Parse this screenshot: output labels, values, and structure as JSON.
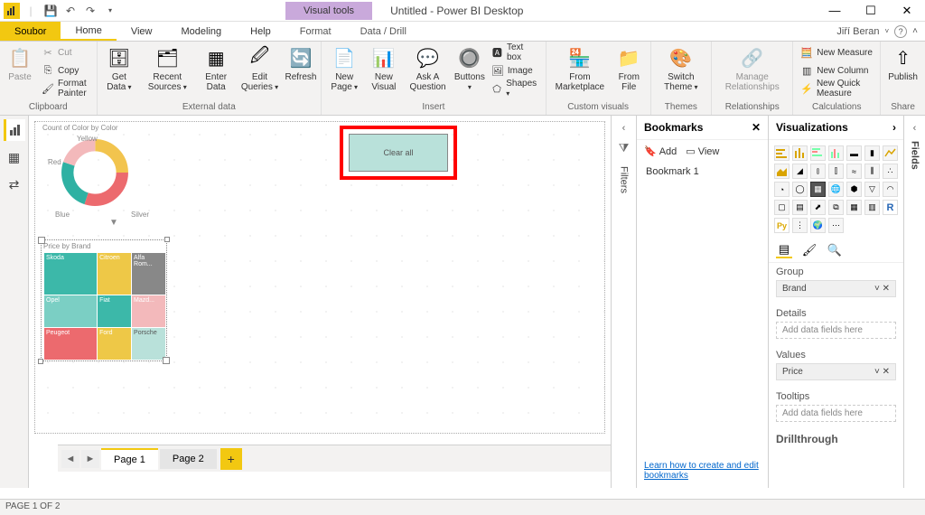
{
  "app": {
    "title": "Untitled - Power BI Desktop",
    "user": "Jiří Beran"
  },
  "menu": {
    "file": "Soubor",
    "home": "Home",
    "view": "View",
    "modeling": "Modeling",
    "help": "Help",
    "format": "Format",
    "datadrill": "Data / Drill",
    "visualtools": "Visual tools"
  },
  "ribbon": {
    "clipboard": {
      "paste": "Paste",
      "cut": "Cut",
      "copy": "Copy",
      "painter": "Format Painter",
      "group": "Clipboard"
    },
    "external": {
      "getdata": "Get\nData",
      "recent": "Recent\nSources",
      "enter": "Enter\nData",
      "edit": "Edit\nQueries",
      "refresh": "Refresh",
      "group": "External data"
    },
    "insert": {
      "newpage": "New\nPage",
      "newvisual": "New\nVisual",
      "ask": "Ask A\nQuestion",
      "buttons": "Buttons",
      "textbox": "Text box",
      "image": "Image",
      "shapes": "Shapes",
      "group": "Insert"
    },
    "custom": {
      "marketplace": "From\nMarketplace",
      "file": "From\nFile",
      "group": "Custom visuals"
    },
    "themes": {
      "switch": "Switch\nTheme",
      "group": "Themes"
    },
    "rel": {
      "manage": "Manage\nRelationships",
      "group": "Relationships"
    },
    "calc": {
      "measure": "New Measure",
      "column": "New Column",
      "quick": "New Quick Measure",
      "group": "Calculations"
    },
    "share": {
      "publish": "Publish",
      "group": "Share"
    }
  },
  "canvas": {
    "donut_title": "Count of Color by Color",
    "legend": {
      "yellow": "Yellow",
      "red": "Red",
      "blue": "Blue",
      "silver": "Silver"
    },
    "treemap_title": "Price by Brand",
    "treemap": {
      "a": "Skoda",
      "b": "Citroen",
      "c": "Alfa Rom...",
      "d": "Opel",
      "e": "Fiat",
      "f": "Mazd...",
      "g": "Peugeot",
      "h": "Ford",
      "i": "Porsche"
    },
    "clearall": "Clear all"
  },
  "filters_label": "Filters",
  "bookmarks": {
    "title": "Bookmarks",
    "add": "Add",
    "view": "View",
    "item1": "Bookmark 1",
    "link": "Learn how to create and edit bookmarks"
  },
  "vis": {
    "title": "Visualizations",
    "group": "Group",
    "brand": "Brand",
    "details": "Details",
    "details_ph": "Add data fields here",
    "values": "Values",
    "price": "Price",
    "tooltips": "Tooltips",
    "tooltips_ph": "Add data fields here",
    "drill": "Drillthrough"
  },
  "fields_label": "Fields",
  "pages": {
    "p1": "Page 1",
    "p2": "Page 2"
  },
  "status": "PAGE 1 OF 2",
  "chart_data": [
    {
      "type": "pie",
      "title": "Count of Color by Color",
      "series": [
        {
          "name": "Color",
          "values": [
            {
              "label": "Yellow",
              "value": 25,
              "color": "#f2c44e"
            },
            {
              "label": "Red",
              "value": 30,
              "color": "#ec6a6e"
            },
            {
              "label": "Blue",
              "value": 25,
              "color": "#2fb1a3"
            },
            {
              "label": "Silver",
              "value": 20,
              "color": "#f3b9bb"
            }
          ]
        }
      ]
    },
    {
      "type": "treemap",
      "title": "Price by Brand",
      "series": [
        {
          "name": "Brand",
          "values": [
            {
              "label": "Skoda",
              "value": 30,
              "color": "#3cb8a9"
            },
            {
              "label": "Citroen",
              "value": 18,
              "color": "#eec847"
            },
            {
              "label": "Alfa Romeo",
              "value": 12,
              "color": "#888888"
            },
            {
              "label": "Opel",
              "value": 14,
              "color": "#7bcfc4"
            },
            {
              "label": "Fiat",
              "value": 8,
              "color": "#3cb8a9"
            },
            {
              "label": "Mazda",
              "value": 6,
              "color": "#f3b9bb"
            },
            {
              "label": "Peugeot",
              "value": 8,
              "color": "#ec6a6e"
            },
            {
              "label": "Ford",
              "value": 6,
              "color": "#eec847"
            },
            {
              "label": "Porsche",
              "value": 5,
              "color": "#b9e1da"
            }
          ]
        }
      ]
    }
  ]
}
